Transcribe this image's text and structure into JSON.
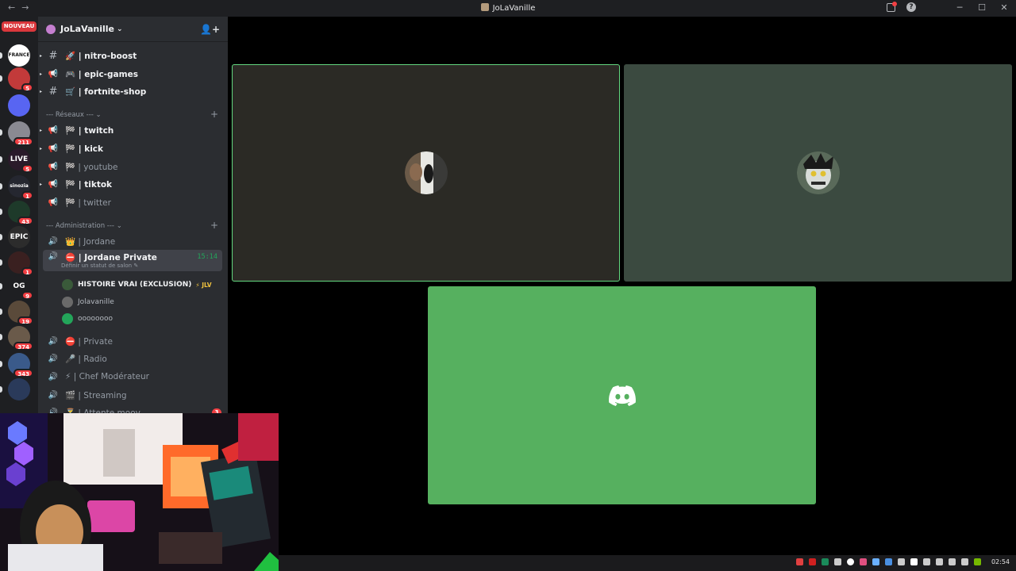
{
  "window": {
    "title": "JoLaVanille",
    "nav_back": "←",
    "nav_forward": "→",
    "controls": [
      "─",
      "☐",
      "✕"
    ]
  },
  "rail": {
    "new_label": "NOUVEAU",
    "servers": [
      {
        "name": "france-server",
        "text": "FRANCE",
        "color": "#ffffff",
        "badge": ""
      },
      {
        "name": "anime-server",
        "text": "",
        "color": "#c23a3a",
        "badge": "5"
      },
      {
        "name": "folder",
        "text": "",
        "color": "#5865f2",
        "badge": ""
      },
      {
        "name": "server-211",
        "text": "",
        "color": "#8a8a92",
        "badge": "211"
      },
      {
        "name": "live-server",
        "text": "LIVE",
        "color": "#2a1a2a",
        "badge": "5"
      },
      {
        "name": "sinozia-server",
        "text": "sinozia",
        "color": "#252730",
        "badge": "1"
      },
      {
        "name": "eye-server",
        "text": "",
        "color": "#1e3a2a",
        "badge": "43"
      },
      {
        "name": "epic-server",
        "text": "EPIC",
        "color": "#2c2c2c",
        "badge": ""
      },
      {
        "name": "dark-server",
        "text": "",
        "color": "#3a2020",
        "badge": "1"
      },
      {
        "name": "og-server",
        "text": "OG",
        "color": "#1e1f22",
        "badge": "9"
      },
      {
        "name": "server-19",
        "text": "",
        "color": "#5a4a3a",
        "badge": "19"
      },
      {
        "name": "server-374",
        "text": "",
        "color": "#6a5a4a",
        "badge": "374"
      },
      {
        "name": "server-343",
        "text": "",
        "color": "#3a5a8a",
        "badge": "343"
      },
      {
        "name": "server-last",
        "text": "",
        "color": "#2a3a5a",
        "badge": ""
      }
    ]
  },
  "guild": {
    "name": "JoLaVanille",
    "chevron": "⌄",
    "invite_icon": "👤+"
  },
  "channels_top": [
    {
      "kind": "#",
      "emoji": "🚀",
      "name": "| nitro-boost",
      "bold": true
    },
    {
      "kind": "📢",
      "emoji": "🎮",
      "name": "| epic-games",
      "bold": true
    },
    {
      "kind": "#",
      "emoji": "🛒",
      "name": "| fortnite-shop",
      "bold": true
    }
  ],
  "categories": {
    "reseaux": "--- Réseaux ---  ⌄",
    "administration": "--- Administration ---  ⌄",
    "plus": "+"
  },
  "channels_reseaux": [
    {
      "emoji": "🏁",
      "name": "| twitch",
      "bold": true
    },
    {
      "emoji": "🏁",
      "name": "| kick",
      "bold": true
    },
    {
      "emoji": "🏁",
      "name": "| youtube",
      "bold": false
    },
    {
      "emoji": "🏁",
      "name": "| tiktok",
      "bold": true
    },
    {
      "emoji": "🏁",
      "name": "| twitter",
      "bold": false
    }
  ],
  "channels_admin": {
    "jordane": {
      "emoji": "👑",
      "name": "| Jordane"
    },
    "private_active": {
      "emoji": "⛔",
      "name": "| Jordane Private",
      "timer": "15:14",
      "status": "Définir un statut de salon ✎"
    },
    "voice_users": [
      {
        "name": "HISTOIRE VRAI (EXCLUSION)",
        "tag": "⚡ JLV",
        "color": "#3a5a3a",
        "strong": true
      },
      {
        "name": "Jolavanille",
        "tag": "",
        "color": "#6a6a6a",
        "strong": false
      },
      {
        "name": "oooooooo",
        "tag": "",
        "color": "#23a55a",
        "strong": false
      }
    ],
    "more": [
      {
        "emoji": "⛔",
        "name": "| Private"
      },
      {
        "emoji": "🎤",
        "name": "|  Radio"
      },
      {
        "emoji": "⚡",
        "name": "| Chef Modérateur"
      },
      {
        "emoji": "🎬",
        "name": "| Streaming"
      },
      {
        "emoji": "⏳",
        "name": "| Attente moov",
        "mention": "3"
      }
    ]
  },
  "stage": {
    "tiles": [
      {
        "name": "user-tile-1",
        "speaking": true
      },
      {
        "name": "user-tile-2",
        "speaking": false
      },
      {
        "name": "discord-default-tile",
        "speaking": false
      }
    ]
  },
  "taskbar": {
    "clock": "02:54"
  },
  "colors": {
    "accent_green": "#23a55a",
    "speaking_border": "#62d77f",
    "discord_tile": "#56b05f",
    "mention_red": "#f23f43"
  }
}
